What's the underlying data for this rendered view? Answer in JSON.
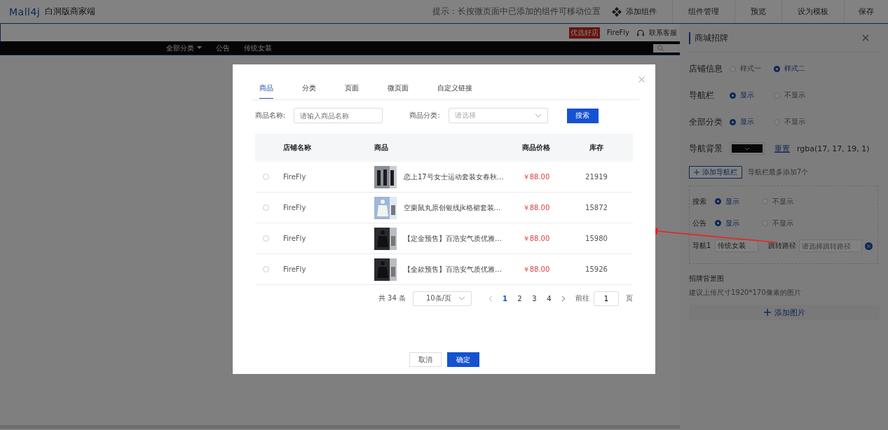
{
  "header": {
    "logo": "Mall4j",
    "subtitle": "白洞版商家端",
    "hint": "提示：长按微页面中已添加的组件可移动位置",
    "actions": [
      {
        "label": "添加组件",
        "kind": "add"
      },
      {
        "label": "组件管理",
        "kind": "plain"
      },
      {
        "label": "预览",
        "kind": "plain"
      },
      {
        "label": "设为模板",
        "kind": "plain"
      },
      {
        "label": "保存",
        "kind": "plain"
      }
    ]
  },
  "preview": {
    "badge": "优选好店",
    "shop_name": "FireFly",
    "contact": "联系客服",
    "nav": [
      {
        "label": "全部分类",
        "dropdown": true
      },
      {
        "label": "公告",
        "dropdown": false
      },
      {
        "label": "传统女装",
        "dropdown": false
      }
    ]
  },
  "panel": {
    "title": "商城招牌",
    "settings": [
      {
        "label": "店铺信息",
        "options": [
          {
            "label": "样式一",
            "selected": false
          },
          {
            "label": "样式二",
            "selected": true
          }
        ]
      },
      {
        "label": "导航栏",
        "options": [
          {
            "label": "显示",
            "selected": true
          },
          {
            "label": "不显示",
            "selected": false
          }
        ]
      },
      {
        "label": "全部分类",
        "options": [
          {
            "label": "显示",
            "selected": true
          },
          {
            "label": "不显示",
            "selected": false
          }
        ]
      }
    ],
    "nav_background": {
      "label": "导航背景",
      "reset": "重置",
      "value": "rgba(17, 17, 19, 1)"
    },
    "add_nav": {
      "label": "添加导航栏",
      "hint": "导航栏最多添加7个"
    },
    "nav_box": {
      "settings": [
        {
          "label": "搜索",
          "options": [
            {
              "label": "显示",
              "selected": true
            },
            {
              "label": "不显示",
              "selected": false
            }
          ]
        },
        {
          "label": "公告",
          "options": [
            {
              "label": "显示",
              "selected": true
            },
            {
              "label": "不显示",
              "selected": false
            }
          ]
        }
      ],
      "item": {
        "label": "导航1",
        "value": "传统女装",
        "path_label": "跳转路径",
        "path_placeholder": "请选择跳转路径"
      }
    },
    "sign_image": {
      "title": "招牌背景图",
      "hint": "建议上传尺寸1920*170像素的图片",
      "add": "添加图片"
    }
  },
  "modal": {
    "tabs": [
      {
        "label": "商品",
        "selected": true
      },
      {
        "label": "分类",
        "selected": false
      },
      {
        "label": "页面",
        "selected": false
      },
      {
        "label": "微页面",
        "selected": false
      },
      {
        "label": "自定义链接",
        "selected": false
      }
    ],
    "filters": {
      "name_label": "商品名称:",
      "name_placeholder": "请输入商品名称",
      "category_label": "商品分类:",
      "category_placeholder": "请选择",
      "search": "搜索"
    },
    "table": {
      "columns": [
        "店铺名称",
        "商品",
        "商品价格",
        "库存"
      ],
      "rows": [
        {
          "selected": false,
          "store": "FireFly",
          "product": "恋上17号女士运动套装女春秋…",
          "price": "￥88.00",
          "stock": "21919"
        },
        {
          "selected": false,
          "store": "FireFly",
          "product": "空栗鼠丸原创银线jk格裙套装…",
          "price": "￥88.00",
          "stock": "15872"
        },
        {
          "selected": false,
          "store": "FireFly",
          "product": "【定金预售】百浩安气质优雅…",
          "price": "￥88.00",
          "stock": "15980"
        },
        {
          "selected": false,
          "store": "FireFly",
          "product": "【全款预售】百浩安气质优雅…",
          "price": "￥88.00",
          "stock": "15926"
        }
      ]
    },
    "pagination": {
      "total": "共 34 条",
      "page_size": "10条/页",
      "pages": [
        {
          "label": "1",
          "selected": true
        },
        {
          "label": "2",
          "selected": false
        },
        {
          "label": "3",
          "selected": false
        },
        {
          "label": "4",
          "selected": false
        }
      ],
      "goto_label": "前往",
      "goto_value": "1",
      "goto_suffix": "页"
    },
    "buttons": [
      {
        "label": "取消",
        "kind": "secondary"
      },
      {
        "label": "确定",
        "kind": "primary"
      }
    ]
  }
}
